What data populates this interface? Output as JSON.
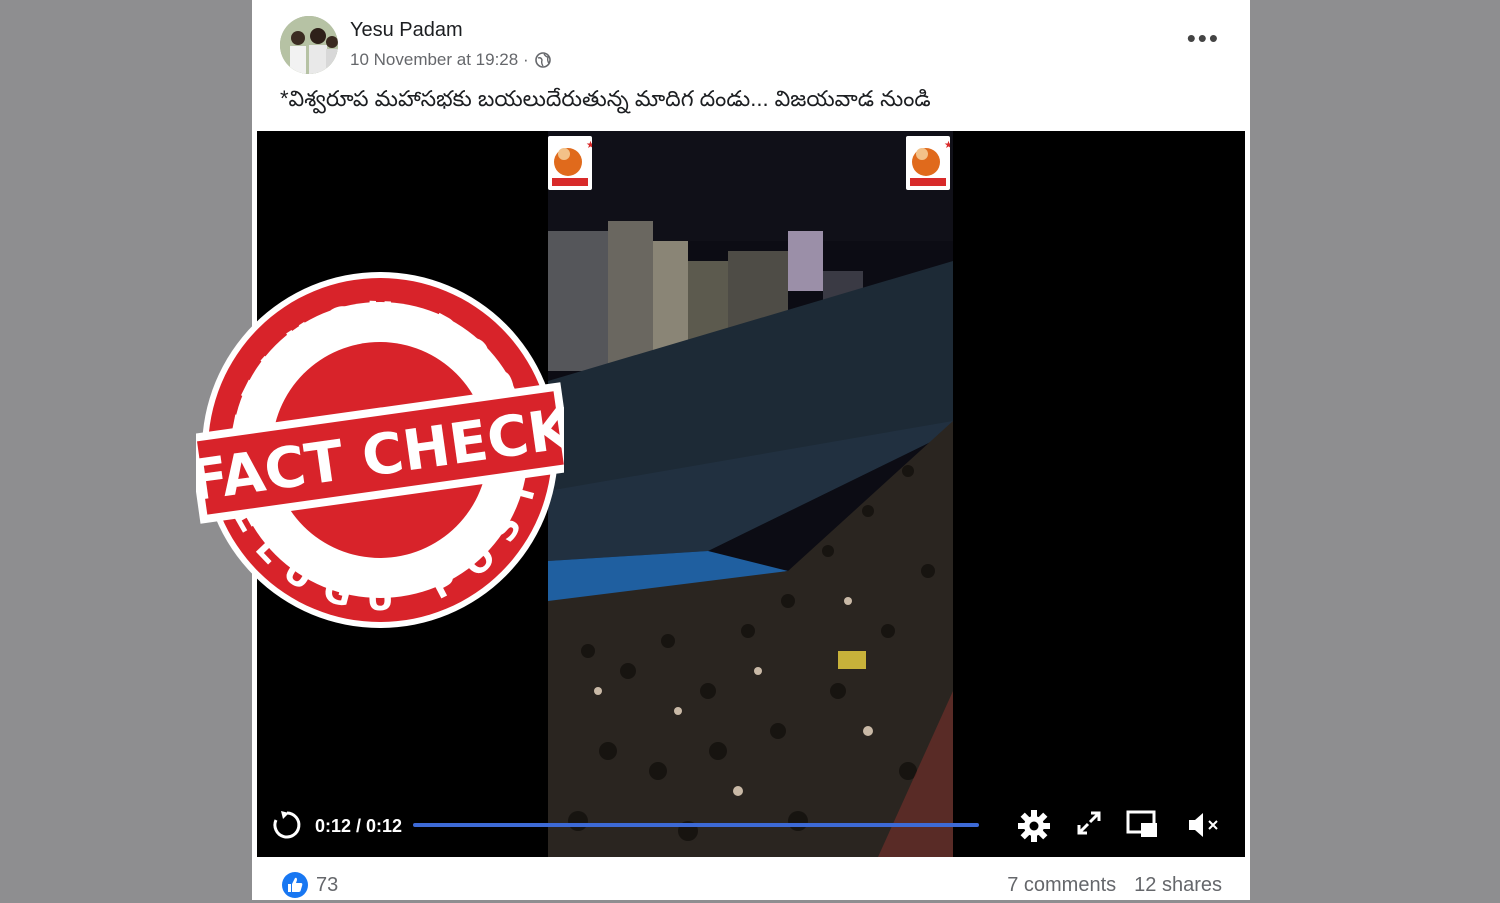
{
  "post": {
    "author": "Yesu Padam",
    "timestamp": "10 November at 19:28 ·",
    "caption": "*విశ్వరూప మహాసభకు బయలుదేరుతున్న మాదిగ దండు... విజయవాడ నుండి",
    "more_label": "•••"
  },
  "video": {
    "time": "0:12 / 0:12",
    "progress": 1.0,
    "icons": [
      "replay-icon",
      "gear-icon",
      "fullscreen-icon",
      "pip-icon",
      "mute-icon"
    ]
  },
  "reactions": {
    "likes": "73",
    "comments": "7 comments",
    "shares": "12 shares"
  },
  "stamp": {
    "top_text": "TELUGU POST",
    "main_text": "FACT CHECK",
    "bottom_text": "TELUGU POST"
  },
  "colors": {
    "stamp_red": "#d8232a",
    "progress": "#3d6ad6",
    "page_bg": "#8e8e90"
  }
}
